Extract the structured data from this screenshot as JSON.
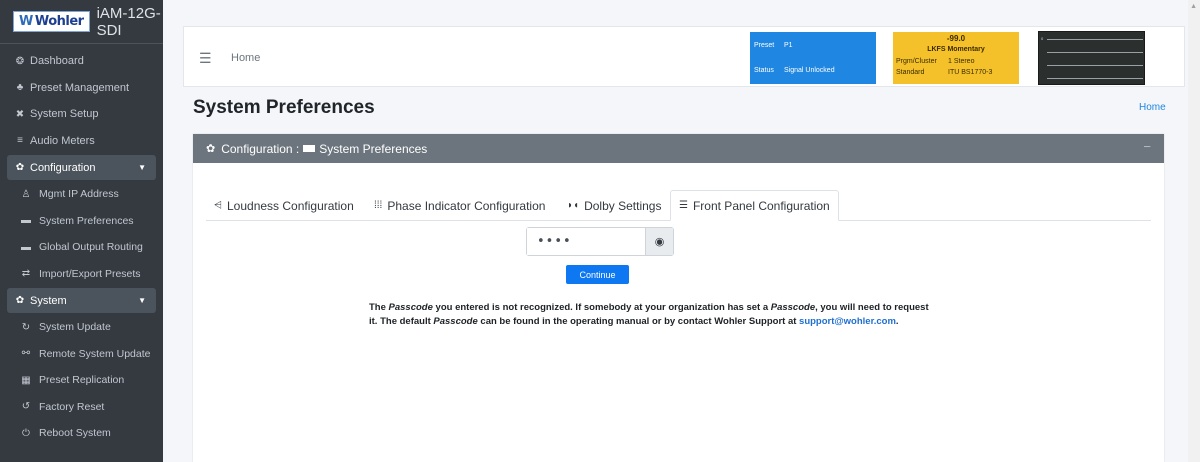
{
  "brand": {
    "logo": "Wohler",
    "name": "iAM-12G-SDI"
  },
  "sidebar": {
    "items": [
      {
        "label": "Dashboard",
        "icon": "dashboard-icon",
        "glyph": "❂"
      },
      {
        "label": "Preset Management",
        "icon": "user-gear-icon",
        "glyph": "♣"
      },
      {
        "label": "System Setup",
        "icon": "tools-icon",
        "glyph": "✖"
      },
      {
        "label": "Audio Meters",
        "icon": "meter-chart-icon",
        "glyph": "≡"
      }
    ],
    "config_group": {
      "label": "Configuration",
      "glyph": "✿"
    },
    "config_items": [
      {
        "label": "Mgmt IP Address",
        "icon": "network-icon",
        "glyph": "♙"
      },
      {
        "label": "System Preferences",
        "icon": "keyboard-icon",
        "glyph": "▬"
      },
      {
        "label": "Global Output Routing",
        "icon": "keyboard-icon",
        "glyph": "▬"
      },
      {
        "label": "Import/Export Presets",
        "icon": "transfer-icon",
        "glyph": "⇄"
      }
    ],
    "system_group": {
      "label": "System",
      "glyph": "✿"
    },
    "system_items": [
      {
        "label": "System Update",
        "icon": "sync-icon",
        "glyph": "↻"
      },
      {
        "label": "Remote System Update",
        "icon": "remote-network-icon",
        "glyph": "⚯"
      },
      {
        "label": "Preset Replication",
        "icon": "database-icon",
        "glyph": "▦"
      },
      {
        "label": "Factory Reset",
        "icon": "undo-icon",
        "glyph": "↺"
      },
      {
        "label": "Reboot System",
        "icon": "power-icon",
        "glyph": "⏻"
      }
    ]
  },
  "header": {
    "home_label": "Home",
    "preset_panel": {
      "preset_label": "Preset",
      "preset_value": "P1",
      "status_label": "Status",
      "status_value": "Signal Unlocked"
    },
    "loudness_panel": {
      "value": "-99.0",
      "mode": "LKFS  Momentary",
      "cluster_label": "Prgm/Cluster",
      "cluster_value": "1  Stereo",
      "standard_label": "Standard",
      "standard_value": "ITU BS1770-3"
    }
  },
  "page": {
    "title": "System Preferences",
    "breadcrumb": "Home"
  },
  "card": {
    "header_prefix": "Configuration :",
    "header_suffix": "System Preferences",
    "collapse": "−"
  },
  "tabs": [
    {
      "label": "Loudness Configuration",
      "icon": "chart-icon",
      "glyph": "⩤"
    },
    {
      "label": "Phase Indicator Configuration",
      "icon": "grid-icon",
      "glyph": "⁞⁞⁞"
    },
    {
      "label": "Dolby Settings",
      "icon": "dolby-icon",
      "glyph": "◗◖"
    },
    {
      "label": "Front Panel Configuration",
      "icon": "list-icon",
      "glyph": "☰"
    }
  ],
  "form": {
    "passcode_value": "••••",
    "continue_label": "Continue"
  },
  "message": {
    "p1": "The ",
    "em1": "Passcode",
    "p2": " you entered is not recognized. If somebody at your organization has set a ",
    "em2": "Passcode",
    "p3": ", you will need to request it. The default ",
    "em3": "Passcode",
    "p4": " can be found in the operating manual or by contact Wohler Support at ",
    "link": "support@wohler.com",
    "p5": "."
  }
}
